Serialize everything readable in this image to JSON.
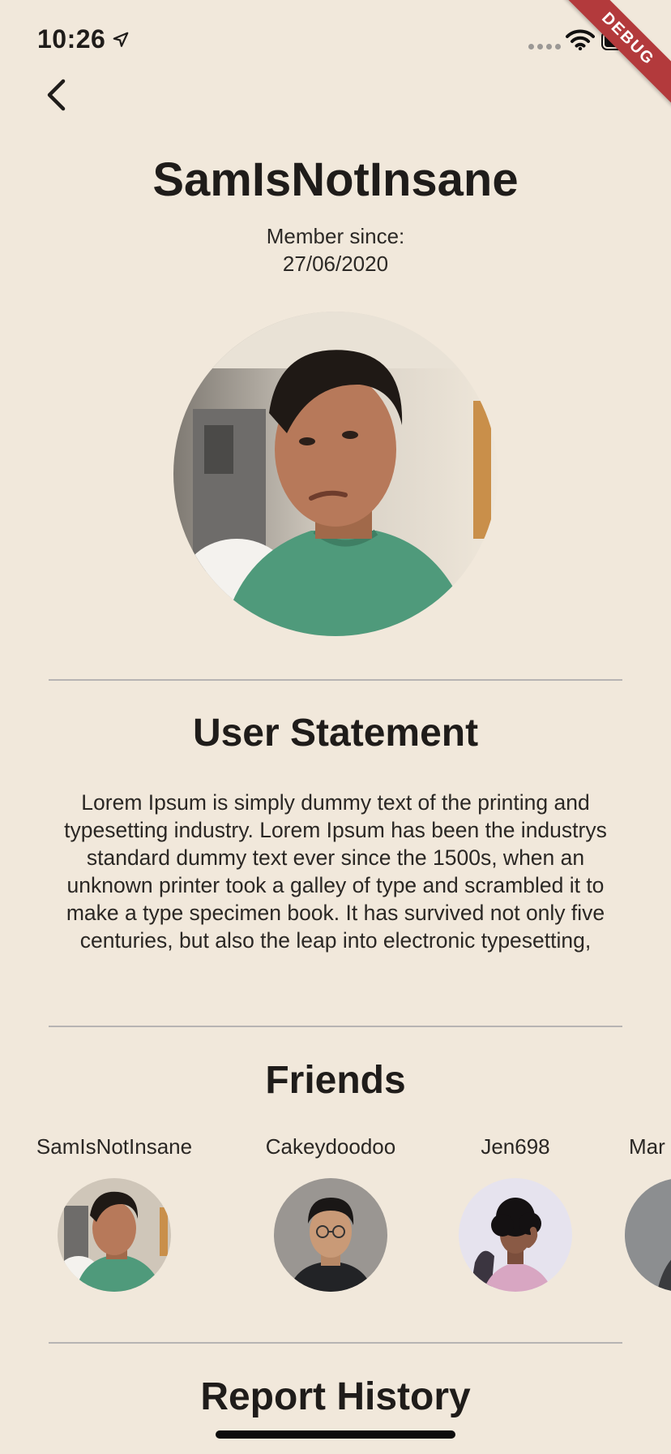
{
  "status_bar": {
    "time": "10:26"
  },
  "debug_banner": {
    "label": "DEBUG"
  },
  "profile": {
    "username": "SamIsNotInsane",
    "member_since_label": "Member since:",
    "member_since_date": "27/06/2020"
  },
  "statement": {
    "title": "User Statement",
    "text": "Lorem Ipsum is simply dummy text of the printing and typesetting industry. Lorem Ipsum has been the industrys standard dummy text ever since the 1500s, when an unknown printer took a galley of type and scrambled it to make a type specimen book. It has survived not only five centuries, but also the leap into electronic typesetting,"
  },
  "friends": {
    "title": "Friends",
    "items": [
      {
        "name": "SamIsNotInsane"
      },
      {
        "name": "Cakeydoodoo"
      },
      {
        "name": "Jen698"
      },
      {
        "name": "Mar"
      }
    ]
  },
  "report_history": {
    "title": "Report History"
  },
  "icons": {
    "back": "chevron-left-icon",
    "location": "location-arrow-icon",
    "wifi": "wifi-icon",
    "battery": "battery-icon"
  },
  "colors": {
    "background": "#f1e8db",
    "text": "#1f1c1a",
    "divider": "#b7b4b3",
    "debug_banner": "#b33a3c"
  }
}
